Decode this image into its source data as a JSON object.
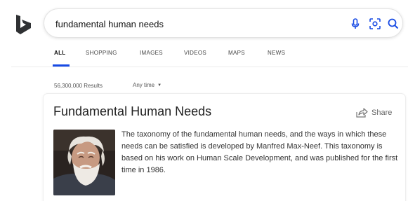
{
  "search": {
    "query": "fundamental human needs"
  },
  "icons": {
    "logo": "bing-logo",
    "mic": "microphone-icon",
    "visual_search": "visual-search-icon",
    "search": "search-icon",
    "share": "share-icon"
  },
  "tabs": [
    {
      "label": "ALL",
      "active": true
    },
    {
      "label": "SHOPPING",
      "active": false
    },
    {
      "label": "IMAGES",
      "active": false
    },
    {
      "label": "VIDEOS",
      "active": false
    },
    {
      "label": "MAPS",
      "active": false
    },
    {
      "label": "NEWS",
      "active": false
    }
  ],
  "filters": {
    "results_count": "56,300,000 Results",
    "time_label": "Any time"
  },
  "card": {
    "title": "Fundamental Human Needs",
    "share_label": "Share",
    "description": "The taxonomy of the fundamental human needs, and the ways in which these needs can be satisfied is developed by Manfred Max-Neef. This taxonomy is based on his work on Human Scale Development, and was published for the first time in 1986."
  },
  "colors": {
    "brand_logo": "#2f3133",
    "icon_blue": "#174ae4",
    "active_tab_underline": "#174ae4"
  }
}
